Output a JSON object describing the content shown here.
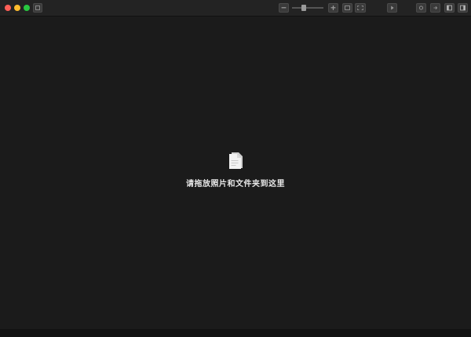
{
  "window": {
    "accent": "#1b1b1b",
    "traffic_lights": {
      "close_color": "#ff5f57",
      "minimize_color": "#febc2e",
      "zoom_color": "#28c840"
    }
  },
  "toolbar": {
    "zoom_level": 0.35,
    "icons": [
      "sidebar-toggle-icon",
      "zoom-out-icon",
      "zoom-in-icon",
      "fit-icon",
      "fullscreen-icon",
      "slideshow-icon",
      "info-icon",
      "share-icon",
      "panel-left-icon",
      "panel-right-icon"
    ]
  },
  "main": {
    "drop_prompt": "请拖放照片和文件夹到这里",
    "drop_icon": "document-icon"
  }
}
